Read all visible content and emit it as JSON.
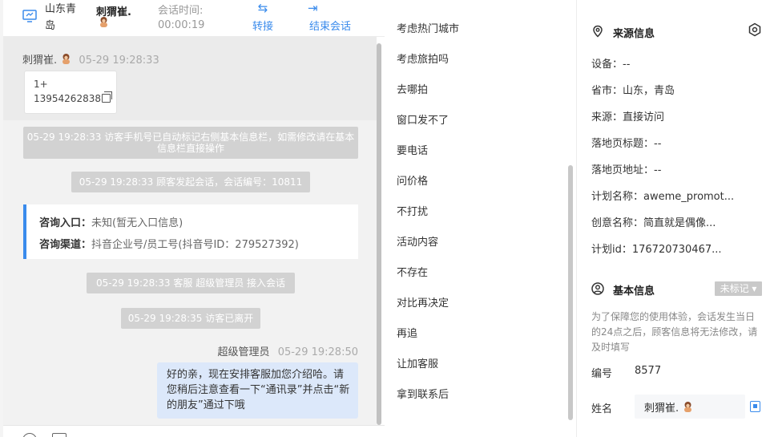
{
  "chat": {
    "header": {
      "location": "山东青岛",
      "visitor_name": "刺猬崔.",
      "session_time_label": "会话时间:",
      "session_time": "00:00:19",
      "transfer_label": "转接",
      "end_label": "结束会话"
    },
    "first_message": {
      "sender": "刺猬崔.",
      "time": "05-29 19:28:33",
      "phone_line1": "1+",
      "phone_line2": "13954262838"
    },
    "system_messages": [
      "05-29 19:28:33 访客手机号已自动标记右侧基本信息栏，如需修改请在基本信息栏直接操作",
      "05-29 19:28:33 顾客发起会话，会话编号：10811",
      "05-29 19:28:33 客服 超级管理员 接入会话",
      "05-29 19:28:35 访客已离开"
    ],
    "consult": {
      "entry_label": "咨询入口：",
      "entry_value": "未知(暂无入口信息)",
      "channel_label": "咨询渠道：",
      "channel_value": "抖音企业号/员工号(抖音号ID：279527392)"
    },
    "agent_message": {
      "sender": "超级管理员",
      "time": "05-29 19:28:50",
      "text": "好的亲，现在安排客服加您介绍哈。请您稍后注意查看一下“通讯录”并点击“新的朋友”通过下哦"
    }
  },
  "quick_replies": [
    "考虑热门城市",
    "考虑旅拍吗",
    "去哪拍",
    "窗口发不了",
    "要电话",
    "问价格",
    "不打扰",
    "活动内容",
    "不存在",
    "对比再决定",
    "再追",
    "让加客服",
    "拿到联系后"
  ],
  "info": {
    "source_title": "来源信息",
    "source_rows": [
      "设备：--",
      "省市：山东，青岛",
      "来源：直接访问",
      "落地页标题：--",
      "落地页地址：--",
      "计划名称：aweme_promot...",
      "创意名称：简直就是偶像...",
      "计划id：176720730467..."
    ],
    "basic_title": "基本信息",
    "tag_label": "未标记",
    "note": "为了保障您的使用体验，会话发生当日的24点之后，顾客信息将无法修改，请及时填写",
    "id_label": "编号",
    "id_value": "8577",
    "name_label": "姓名",
    "name_value": "刺猬崔."
  },
  "colors": {
    "accent": "#3a8bec",
    "system_bg": "#d2d2d2",
    "agent_bubble": "#dce8fa"
  }
}
